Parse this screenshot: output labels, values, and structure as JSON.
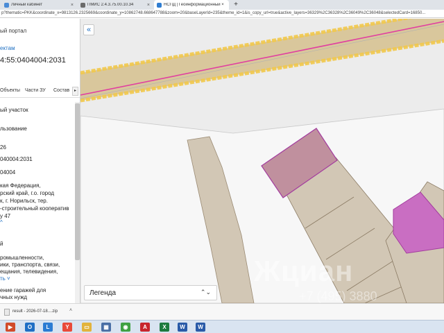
{
  "browser": {
    "tabs": [
      {
        "title": "Личный кабинет",
        "color": "#4a8bd6"
      },
      {
        "title": "ПМИС 2.4.3.75.00.10.34",
        "color": "#6b6b6b"
      },
      {
        "title": "НСПД | Геоинформационный ×",
        "color": "#2f7dd1"
      }
    ],
    "new_tab": "+",
    "close": "×",
    "url": "p?thematic=PKK&coordinate_x=9813126.2325669&coordinate_y=10862748.668647788&zoom=20&baseLayerId=235&theme_id=1&is_copy_url=true&active_layers=36329%2C36328%2C36049%2C36048&selectedCard=16850..."
  },
  "panel": {
    "title": "ый портал",
    "link": "ектам",
    "number": "4:55:0404004:2031",
    "tabs": [
      "Объекты",
      "Части ЗУ",
      "Состав"
    ],
    "tabs_arrow": "▸",
    "lines": [
      "ый участок",
      "льзование",
      "26",
      "040004:2031",
      "04004",
      "кая Федерация,",
      "рский край, г.о. город",
      "к, г. Норильск, тер.",
      "-строительный кооператив",
      "у 47",
      "й",
      "ромышленности,",
      "ики, транспорта, связи,",
      "ещания, телевидения,",
      "ение гаражей для",
      "чных нужд"
    ],
    "expand_1": "^",
    "expand_2": "ть ˅"
  },
  "map": {
    "collapse_icon": "«",
    "legend_label": "Легенда",
    "legend_arrow": "⌃⌄",
    "watermark": "Жциан",
    "watermark_small": "+7 (495) 3880",
    "colors": {
      "background": "#ececec",
      "white_area": "#f7f7f7",
      "parcel": "#d2c7b5",
      "road": "#d9c79c",
      "road_edge": "#f2c94c",
      "pink_line": "#e040a0",
      "selected": "#c0909e",
      "magenta": "#c96ec2"
    }
  },
  "downloads": {
    "file": "result - 2026-07-18....zip",
    "arrow": "˄"
  },
  "taskbar": {
    "icons": [
      {
        "name": "start-icon",
        "glyph": "▶",
        "color": "#d14b2b"
      },
      {
        "name": "outlook-icon",
        "glyph": "O",
        "color": "#1f6fc5"
      },
      {
        "name": "lync-icon",
        "glyph": "L",
        "color": "#2b7cd3"
      },
      {
        "name": "yandex-icon",
        "glyph": "Y",
        "color": "#e94a3a"
      },
      {
        "name": "explorer-icon",
        "glyph": "▭",
        "color": "#e2b33c"
      },
      {
        "name": "app-icon",
        "glyph": "▦",
        "color": "#4a6fa5"
      },
      {
        "name": "chrome-icon",
        "glyph": "◉",
        "color": "#3fa142"
      },
      {
        "name": "acrobat-icon",
        "glyph": "A",
        "color": "#c8262c"
      },
      {
        "name": "mail-icon",
        "glyph": "✉",
        "color": "#5f7fa8"
      },
      {
        "name": "excel-icon",
        "glyph": "X",
        "color": "#1d7a3e"
      },
      {
        "name": "word-icon",
        "glyph": "W",
        "color": "#2a5ba8"
      },
      {
        "name": "word2-icon",
        "glyph": "W",
        "color": "#2a5ba8"
      }
    ]
  }
}
